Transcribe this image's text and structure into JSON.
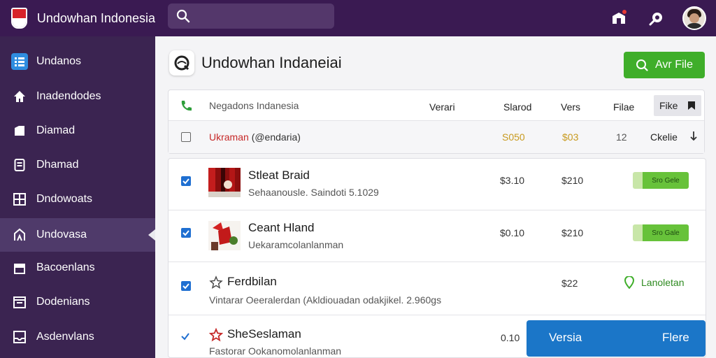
{
  "app": {
    "name": "Undowhan Indonesia"
  },
  "search": {
    "placeholder": ""
  },
  "sidebar": {
    "items": [
      {
        "label": "Undanos"
      },
      {
        "label": "Inadendodes"
      },
      {
        "label": "Diamad"
      },
      {
        "label": "Dhamad"
      },
      {
        "label": "Dndowoats"
      },
      {
        "label": "Undovasa"
      },
      {
        "label": "Bacoenlans"
      },
      {
        "label": "Dodenians"
      },
      {
        "label": "Asdenvlans"
      }
    ]
  },
  "page": {
    "title": "Undowhan Indaneiai",
    "add_button": "Avr File"
  },
  "table": {
    "header": {
      "name": "Negadons Indanesia",
      "columns": [
        "Verari",
        "Slarod",
        "Vers",
        "Filae"
      ],
      "chip": "Fike"
    },
    "filter_row": {
      "label_red": "Ukraman",
      "label_rest": "(@endaria)",
      "v1": "S050",
      "v2": "$03",
      "v3": "12",
      "v4": "Ckelie"
    },
    "rows": [
      {
        "title": "Stleat Braid",
        "subtitle": "Sehaanousle. Saindoti 5.1029",
        "v1": "$3.10",
        "v2": "$210",
        "status": "Sro Gele"
      },
      {
        "title": "Ceant Hland",
        "subtitle": "Uekaramcolanlanman",
        "v1": "$0.10",
        "v2": "$210",
        "status": "Sro Gale"
      },
      {
        "title": "Ferdbilan",
        "subtitle": "Vintarar Oeeralerdan (Akldiouadan odakjikel. 2.960gs",
        "v1": "",
        "v2": "$22",
        "status_text": "Lanoletan"
      },
      {
        "title": "SheSeslaman",
        "subtitle": "Fastorar Ookanomolanlanman",
        "v1": "0.10",
        "v2": ""
      }
    ]
  },
  "bottom_button": {
    "left": "Versia",
    "right": "Flere"
  },
  "colors": {
    "topbar": "#3a1a52",
    "sidebar": "#3b2451",
    "accent_green": "#3fae2a",
    "accent_blue": "#1b76c8",
    "checkbox": "#1f6fd1"
  }
}
